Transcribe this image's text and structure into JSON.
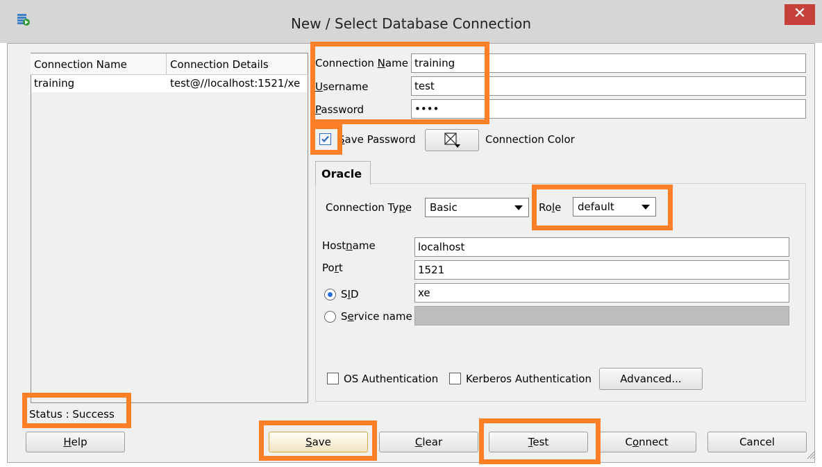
{
  "window": {
    "title": "New / Select Database Connection",
    "close_glyph": "✕",
    "icon": "database-connection-icon"
  },
  "connections_table": {
    "columns": [
      "Connection Name",
      "Connection Details"
    ],
    "rows": [
      {
        "name": "training",
        "details": "test@//localhost:1521/xe"
      }
    ]
  },
  "form": {
    "connection_name": {
      "label_pre": "Connection ",
      "label_ul": "N",
      "label_post": "ame",
      "value": "training"
    },
    "username": {
      "label_pre": "",
      "label_ul": "U",
      "label_post": "sername",
      "value": "test"
    },
    "password": {
      "label_pre": "",
      "label_ul": "P",
      "label_post": "assword",
      "value": "••••"
    },
    "save_password": {
      "label_pre": "",
      "label_ul": "S",
      "label_post": "ave Password",
      "checked": true
    },
    "connection_color": {
      "label": "Connection Color"
    }
  },
  "oracle_tab": {
    "tab_label": "Oracle",
    "connection_type": {
      "label_pre": "Connection Ty",
      "label_ul": "p",
      "label_post": "e",
      "value": "Basic"
    },
    "role": {
      "label_pre": "Ro",
      "label_ul": "l",
      "label_post": "e",
      "value": "default"
    },
    "hostname": {
      "label_pre": "Host",
      "label_ul": "n",
      "label_post": "ame",
      "value": "localhost"
    },
    "port": {
      "label_pre": "Po",
      "label_ul": "r",
      "label_post": "t",
      "value": "1521"
    },
    "sid": {
      "label_pre": "S",
      "label_ul": "I",
      "label_post": "D",
      "value": "xe",
      "selected": true
    },
    "service_name": {
      "label_pre": "S",
      "label_ul": "e",
      "label_post": "rvice name",
      "value": "",
      "selected": false
    },
    "os_auth": {
      "label": "OS Authentication",
      "checked": false
    },
    "kerberos_auth": {
      "label": "Kerberos Authentication",
      "checked": false
    },
    "advanced_button": "Advanced..."
  },
  "status": {
    "text": "Status : Success"
  },
  "buttons": {
    "help": {
      "ul": "H",
      "post": "elp"
    },
    "save": {
      "ul": "S",
      "post": "ave"
    },
    "clear": {
      "ul": "C",
      "post": "lear"
    },
    "test": {
      "ul": "T",
      "post": "est"
    },
    "connect": {
      "pre": "C",
      "ul": "o",
      "post": "nnect"
    },
    "cancel": {
      "label": "Cancel"
    }
  },
  "colors": {
    "highlight": "#ff7f27",
    "close_button": "#c7413a",
    "checkbox_accent": "#2e6dbd"
  }
}
